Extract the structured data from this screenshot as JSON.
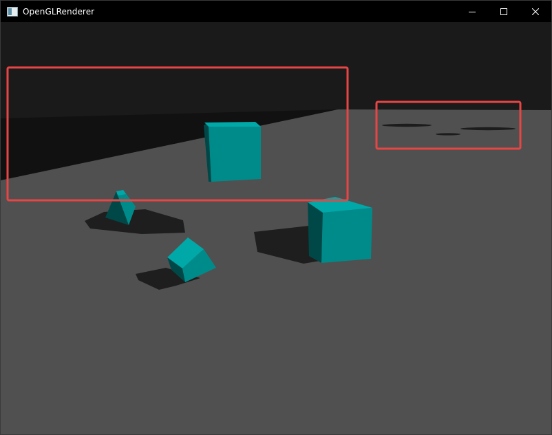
{
  "window": {
    "title": "OpenGLRenderer",
    "icons": {
      "app": "app-window-icon",
      "minimize": "minimize-icon",
      "maximize": "maximize-icon",
      "close": "close-icon"
    }
  },
  "scene": {
    "colors": {
      "background": "#1a1a1a",
      "floor": "#505050",
      "shadow": "#1e1e1e",
      "cube_light": "#008b8b",
      "cube_dark": "#004848",
      "cube_top": "#00a8a8",
      "annotation": "#e84545"
    }
  }
}
